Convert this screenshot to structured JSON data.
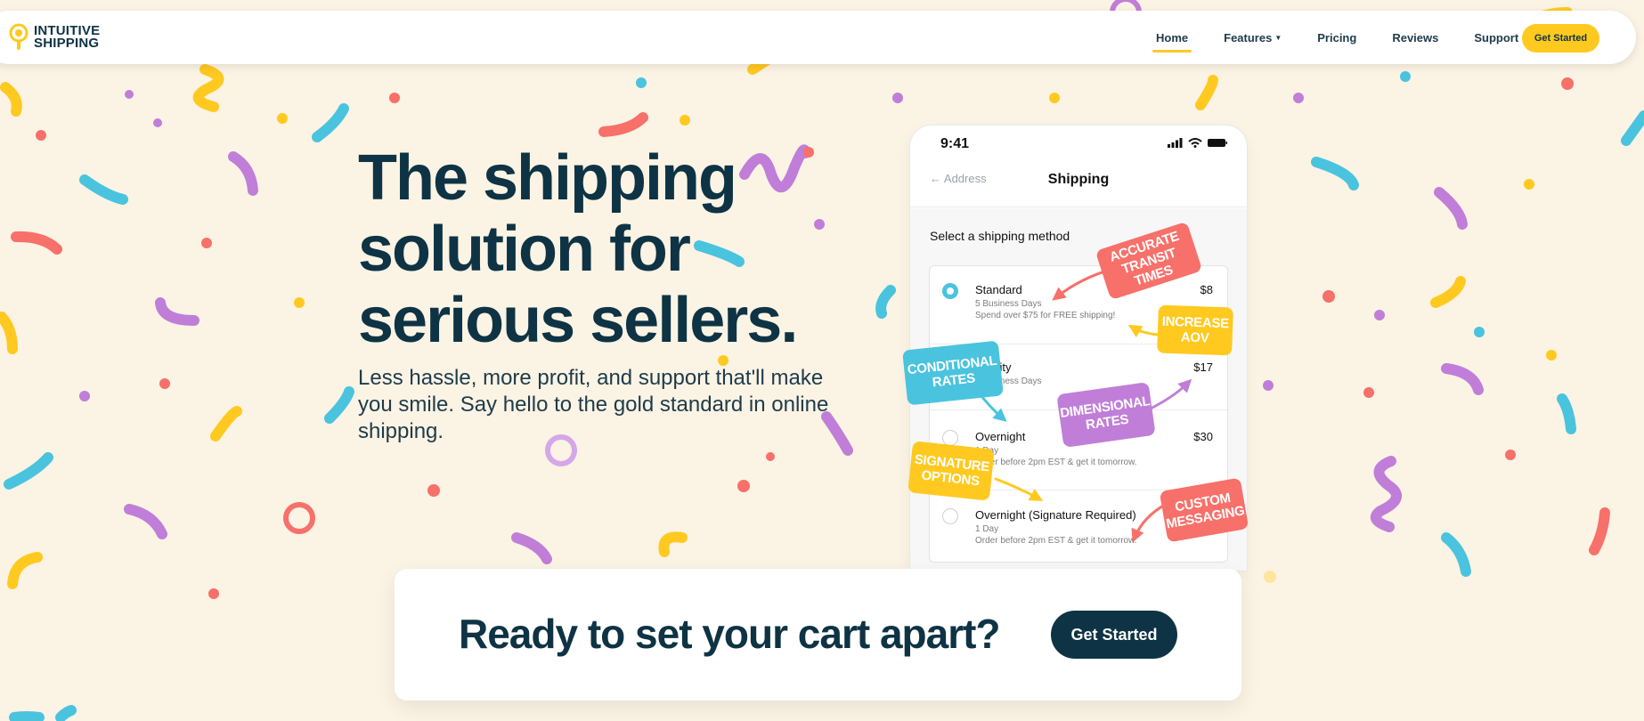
{
  "brand": {
    "line1": "INTUITIVE",
    "line2": "SHIPPING",
    "accent": "#ffc91f",
    "navy": "#0e3344"
  },
  "nav": {
    "items": [
      {
        "label": "Home",
        "active": true
      },
      {
        "label": "Features",
        "dropdown": true
      },
      {
        "label": "Pricing"
      },
      {
        "label": "Reviews"
      },
      {
        "label": "Support",
        "dropdown": true
      }
    ],
    "cta": "Get Started"
  },
  "hero": {
    "title_line1": "The shipping",
    "title_line2": "solution for",
    "title_line3": "serious sellers.",
    "subtitle": "Less hassle, more profit, and support that'll make you smile. Say hello to the gold standard in online shipping."
  },
  "phone": {
    "time": "9:41",
    "back": "Address",
    "title": "Shipping",
    "section_label": "Select a shipping method",
    "options": [
      {
        "name": "Standard",
        "days": "5 Business Days",
        "note": "Spend over $75 for FREE shipping!",
        "price": "$8",
        "selected": true
      },
      {
        "name": "Priority",
        "days": "3 Business Days",
        "note": "",
        "price": "$17",
        "selected": false
      },
      {
        "name": "Overnight",
        "days": "1 Day",
        "note": "Order before 2pm EST & get it tomorrow.",
        "price": "$30",
        "selected": false
      },
      {
        "name": "Overnight (Signature Required)",
        "days": "1 Day",
        "note": "Order before 2pm EST & get it tomorrow.",
        "price": "",
        "selected": false
      }
    ]
  },
  "tags": {
    "transit": {
      "line1": "ACCURATE",
      "line2": "TRANSIT TIMES",
      "color": "#f7706a"
    },
    "aov": {
      "line1": "INCREASE",
      "line2": "AOV",
      "color": "#ffc91f"
    },
    "conditional": {
      "line1": "CONDITIONAL",
      "line2": "RATES",
      "color": "#4ac3de"
    },
    "dimensional": {
      "line1": "DIMENSIONAL",
      "line2": "RATES",
      "color": "#c07ed8"
    },
    "signature": {
      "line1": "SIGNATURE",
      "line2": "OPTIONS",
      "color": "#ffc91f"
    },
    "custom": {
      "line1": "CUSTOM",
      "line2": "MESSAGING",
      "color": "#f7706a"
    }
  },
  "cta_bar": {
    "text": "Ready to set your cart apart?",
    "button": "Get Started"
  },
  "confetti_colors": [
    "#ffc91f",
    "#4ac3de",
    "#f7706a",
    "#c07ed8"
  ]
}
